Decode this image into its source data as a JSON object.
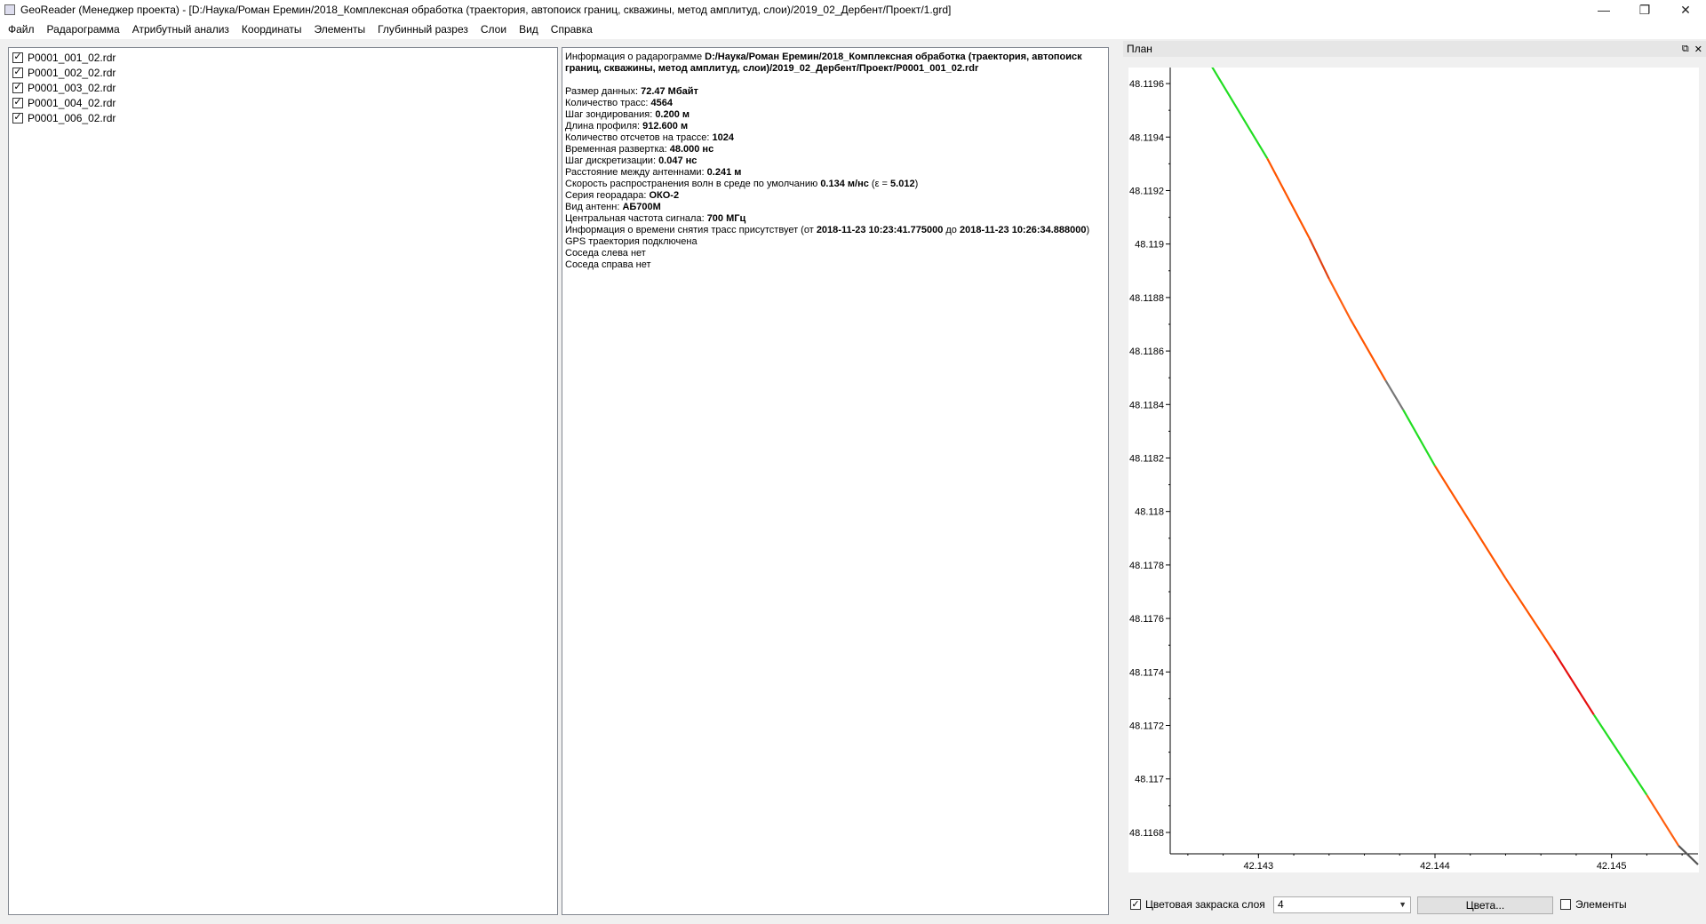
{
  "window": {
    "title": "GeoReader (Менеджер проекта) - [D:/Наука/Роман Еремин/2018_Комплексная обработка (траектория, автопоиск границ, скважины, метод амплитуд, слои)/2019_02_Дербент/Проект/1.grd]",
    "minimize_icon": "minimize-icon",
    "restore_icon": "restore-icon",
    "close_icon": "close-icon"
  },
  "menu": {
    "items": [
      "Файл",
      "Радарограмма",
      "Атрибутный анализ",
      "Координаты",
      "Элементы",
      "Глубинный разрез",
      "Слои",
      "Вид",
      "Справка"
    ]
  },
  "files": [
    {
      "name": "P0001_001_02.rdr",
      "checked": true
    },
    {
      "name": "P0001_002_02.rdr",
      "checked": true
    },
    {
      "name": "P0001_003_02.rdr",
      "checked": true
    },
    {
      "name": "P0001_004_02.rdr",
      "checked": true
    },
    {
      "name": "P0001_006_02.rdr",
      "checked": true
    }
  ],
  "info": {
    "header_label": "Информация о радарограмме ",
    "header_path": "D:/Наука/Роман Еремин/2018_Комплексная обработка (траектория, автопоиск границ, скважины, метод амплитуд, слои)/2019_02_Дербент/Проект/P0001_001_02.rdr",
    "rows": [
      {
        "label": "Размер данных: ",
        "value": "72.47 Мбайт"
      },
      {
        "label": "Количество трасс: ",
        "value": "4564"
      },
      {
        "label": "Шаг зондирования: ",
        "value": "0.200 м"
      },
      {
        "label": "Длина профиля: ",
        "value": "912.600 м"
      },
      {
        "label": "Количество отсчетов на трассе: ",
        "value": "1024"
      },
      {
        "label": "Временная развертка: ",
        "value": "48.000 нс"
      },
      {
        "label": "Шаг дискретизации: ",
        "value": "0.047 нс"
      },
      {
        "label": "Расстояние между антеннами: ",
        "value": "0.241 м"
      },
      {
        "label": "Скорость распространения волн в среде по умолчанию ",
        "value": "0.134 м/нс",
        "suffix": " (ε = ",
        "value2": "5.012",
        "suffix2": ")"
      },
      {
        "label": "Серия георадара: ",
        "value": "ОКО-2"
      },
      {
        "label": "Вид антенн: ",
        "value": "АБ700М"
      },
      {
        "label": "Центральная частота сигнала: ",
        "value": "700 МГц"
      }
    ],
    "time_info": {
      "prefix": "Информация о времени снятия трасс присутствует (от ",
      "from": "2018-11-23 10:23:41.775000",
      "middle": " до ",
      "to": "2018-11-23 10:26:34.888000",
      "suffix": ")"
    },
    "tail": [
      "GPS траектория подключена",
      "Соседа слева нет",
      "Соседа справа нет"
    ]
  },
  "plan_dock": {
    "title": "План",
    "float_icon": "float-icon",
    "close_icon": "close-icon"
  },
  "chart_data": {
    "type": "line",
    "title": "",
    "xlabel": "",
    "ylabel": "",
    "xlim": [
      42.1425,
      42.14549
    ],
    "ylim": [
      48.11672,
      48.11966
    ],
    "x_ticks": [
      "42.143",
      "42.144",
      "42.145"
    ],
    "x_tick_values": [
      42.143,
      42.144,
      42.145
    ],
    "y_ticks": [
      "48.1196",
      "48.1194",
      "48.1192",
      "48.119",
      "48.1188",
      "48.1186",
      "48.1184",
      "48.1182",
      "48.118",
      "48.1178",
      "48.1176",
      "48.1174",
      "48.1172",
      "48.117",
      "48.1168"
    ],
    "y_tick_values": [
      48.1196,
      48.1194,
      48.1192,
      48.119,
      48.1188,
      48.1186,
      48.1184,
      48.1182,
      48.118,
      48.1178,
      48.1176,
      48.1174,
      48.1172,
      48.117,
      48.1168
    ],
    "grid": false,
    "segments": [
      {
        "from": [
          42.14273,
          48.11967
        ],
        "to": [
          42.14305,
          48.11932
        ],
        "color": "#22dd22"
      },
      {
        "from": [
          42.14305,
          48.11932
        ],
        "to": [
          42.14329,
          48.11902
        ],
        "color": "#ff5500"
      },
      {
        "from": [
          42.14329,
          48.11902
        ],
        "to": [
          42.1434,
          48.11887
        ],
        "color": "#e04010"
      },
      {
        "from": [
          42.1434,
          48.11887
        ],
        "to": [
          42.14352,
          48.11872
        ],
        "color": "#ff6010"
      },
      {
        "from": [
          42.14352,
          48.11872
        ],
        "to": [
          42.14372,
          48.11849
        ],
        "color": "#ff5500"
      },
      {
        "from": [
          42.14372,
          48.11849
        ],
        "to": [
          42.14382,
          48.11838
        ],
        "color": "#777777"
      },
      {
        "from": [
          42.14382,
          48.11838
        ],
        "to": [
          42.144,
          48.11817
        ],
        "color": "#22dd22"
      },
      {
        "from": [
          42.144,
          48.11817
        ],
        "to": [
          42.1444,
          48.11775
        ],
        "color": "#ff5500"
      },
      {
        "from": [
          42.1444,
          48.11775
        ],
        "to": [
          42.14467,
          48.11748
        ],
        "color": "#ff5500"
      },
      {
        "from": [
          42.14467,
          48.11748
        ],
        "to": [
          42.1449,
          48.11724
        ],
        "color": "#e51010"
      },
      {
        "from": [
          42.1449,
          48.11724
        ],
        "to": [
          42.1452,
          48.11694
        ],
        "color": "#22dd22"
      },
      {
        "from": [
          42.1452,
          48.11694
        ],
        "to": [
          42.14538,
          48.11675
        ],
        "color": "#ff6010"
      },
      {
        "from": [
          42.14538,
          48.11675
        ],
        "to": [
          42.14549,
          48.11668
        ],
        "color": "#555555"
      }
    ]
  },
  "bottom": {
    "color_fill_label": "Цветовая закраска слоя",
    "color_fill_checked": true,
    "layer_value": "4",
    "colors_button": "Цвета...",
    "elements_label": "Элементы",
    "elements_checked": false
  }
}
